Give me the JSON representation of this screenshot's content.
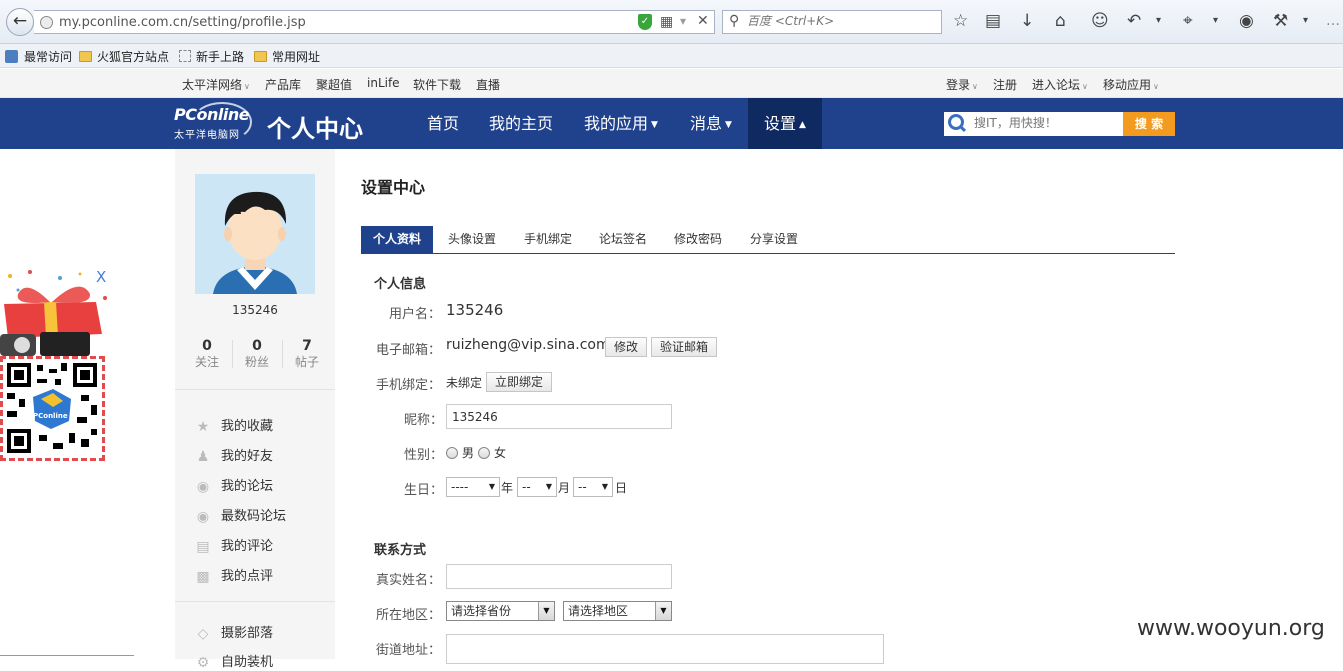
{
  "browser": {
    "url": "my.pconline.com.cn/setting/profile.jsp",
    "search_placeholder": "百度 <Ctrl+K>"
  },
  "bookmarks": [
    "最常访问",
    "火狐官方站点",
    "新手上路",
    "常用网址"
  ],
  "site_toplinks": {
    "left": [
      "太平洋网络",
      "产品库",
      "聚超值",
      "inLife",
      "软件下载",
      "直播"
    ],
    "right": [
      "登录",
      "注册",
      "进入论坛",
      "移动应用"
    ]
  },
  "logo": {
    "main": "PConline",
    "sub": "太平洋电脑网"
  },
  "site_name": "个人中心",
  "nav": [
    "首页",
    "我的主页",
    "我的应用",
    "消息",
    "设置"
  ],
  "site_search": {
    "placeholder": "搜IT，用快搜！",
    "button": "搜 索"
  },
  "profile": {
    "username": "135246",
    "stats": [
      {
        "num": "0",
        "label": "关注"
      },
      {
        "num": "0",
        "label": "粉丝"
      },
      {
        "num": "7",
        "label": "帖子"
      }
    ],
    "links": [
      "我的收藏",
      "我的好友",
      "我的论坛",
      "最数码论坛",
      "我的评论",
      "我的点评"
    ],
    "links2": [
      "摄影部落",
      "自助装机"
    ]
  },
  "main": {
    "title": "设置中心",
    "tabs": [
      "个人资料",
      "头像设置",
      "手机绑定",
      "论坛签名",
      "修改密码",
      "分享设置"
    ],
    "personal_section": "个人信息",
    "username_label": "用户名：",
    "username_value": "135246",
    "email_label": "电子邮箱：",
    "email_value": "ruizheng@vip.sina.com",
    "email_modify_btn": "修改",
    "email_verify_btn": "验证邮箱",
    "phone_label": "手机绑定：",
    "phone_status": "未绑定",
    "phone_bind_btn": "立即绑定",
    "nickname_label": "昵称：",
    "nickname_value": "135246",
    "gender_label": "性别：",
    "gender_male": "男",
    "gender_female": "女",
    "birthday_label": "生日：",
    "birthday_year": "----",
    "birthday_month": "--",
    "birthday_day": "--",
    "unit_year": "年",
    "unit_month": "月",
    "unit_day": "日",
    "contact_section": "联系方式",
    "realname_label": "真实姓名：",
    "region_label": "所在地区：",
    "province_select": "请选择省份",
    "district_select": "请选择地区",
    "street_label": "街道地址："
  },
  "ad": {
    "close": "X",
    "qr_logo": "PConline"
  },
  "watermark": "www.wooyun.org",
  "colors": {
    "nav_blue": "#20428c",
    "nav_active": "#0f2a61",
    "search_orange": "#f39b1e"
  }
}
